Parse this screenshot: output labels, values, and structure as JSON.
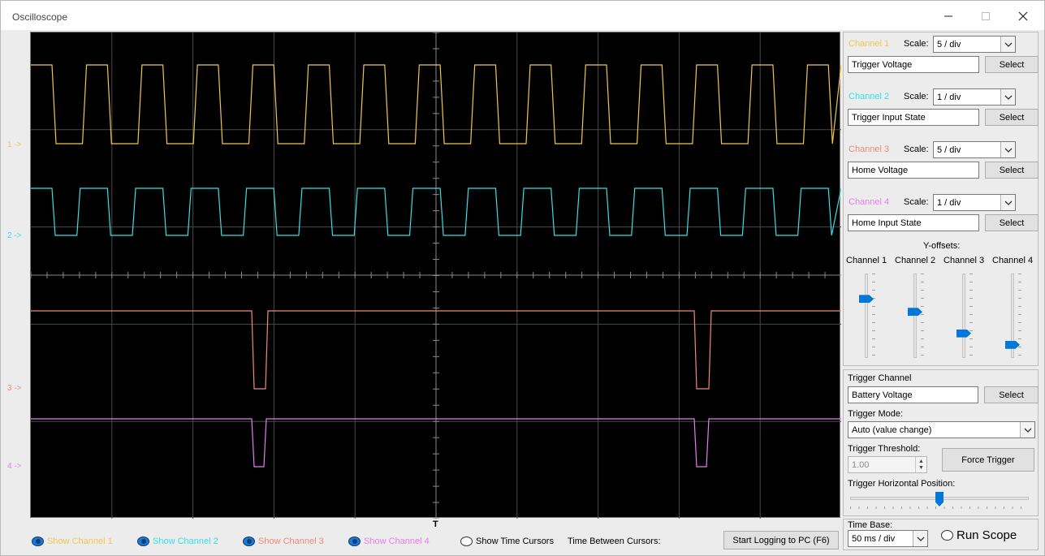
{
  "window": {
    "title": "Oscilloscope"
  },
  "colors": {
    "ch1": "#f3c64b",
    "ch2": "#35e0e8",
    "ch3": "#f08a78",
    "ch4": "#e57ef0",
    "grid": "#4a4a4a",
    "accent": "#0078d7"
  },
  "markers": {
    "ch1": "1 ->",
    "ch2": "2 ->",
    "ch3": "3 ->",
    "ch4": "4 ->",
    "trigger": "T"
  },
  "channels": [
    {
      "label": "Channel 1",
      "scale_label": "Scale:",
      "scale": "5 / div",
      "signal": "Trigger Voltage",
      "select": "Select"
    },
    {
      "label": "Channel 2",
      "scale_label": "Scale:",
      "scale": "1 / div",
      "signal": "Trigger Input State",
      "select": "Select"
    },
    {
      "label": "Channel 3",
      "scale_label": "Scale:",
      "scale": "5 / div",
      "signal": "Home Voltage",
      "select": "Select"
    },
    {
      "label": "Channel 4",
      "scale_label": "Scale:",
      "scale": "1 / div",
      "signal": "Home Input State",
      "select": "Select"
    }
  ],
  "yoffsets": {
    "title": "Y-offsets:",
    "labels": [
      "Channel 1",
      "Channel 2",
      "Channel 3",
      "Channel 4"
    ],
    "levels": [
      0.72,
      0.55,
      0.27,
      0.12
    ]
  },
  "trigger": {
    "channel_label": "Trigger Channel",
    "channel_value": "Battery Voltage",
    "select": "Select",
    "mode_label": "Trigger Mode:",
    "mode_value": "Auto (value change)",
    "threshold_label": "Trigger Threshold:",
    "threshold_value": "1.00",
    "force": "Force Trigger",
    "hpos_label": "Trigger Horizontal Position:",
    "hpos_level": 0.5
  },
  "timebase": {
    "label": "Time Base:",
    "value": "50 ms / div",
    "run": "Run Scope"
  },
  "bottom": {
    "show1": "Show Channel 1",
    "show2": "Show Channel 2",
    "show3": "Show Channel 3",
    "show4": "Show Channel 4",
    "cursors": "Show Time Cursors",
    "between": "Time Between Cursors:",
    "logging": "Start Logging to PC (F6)"
  }
}
